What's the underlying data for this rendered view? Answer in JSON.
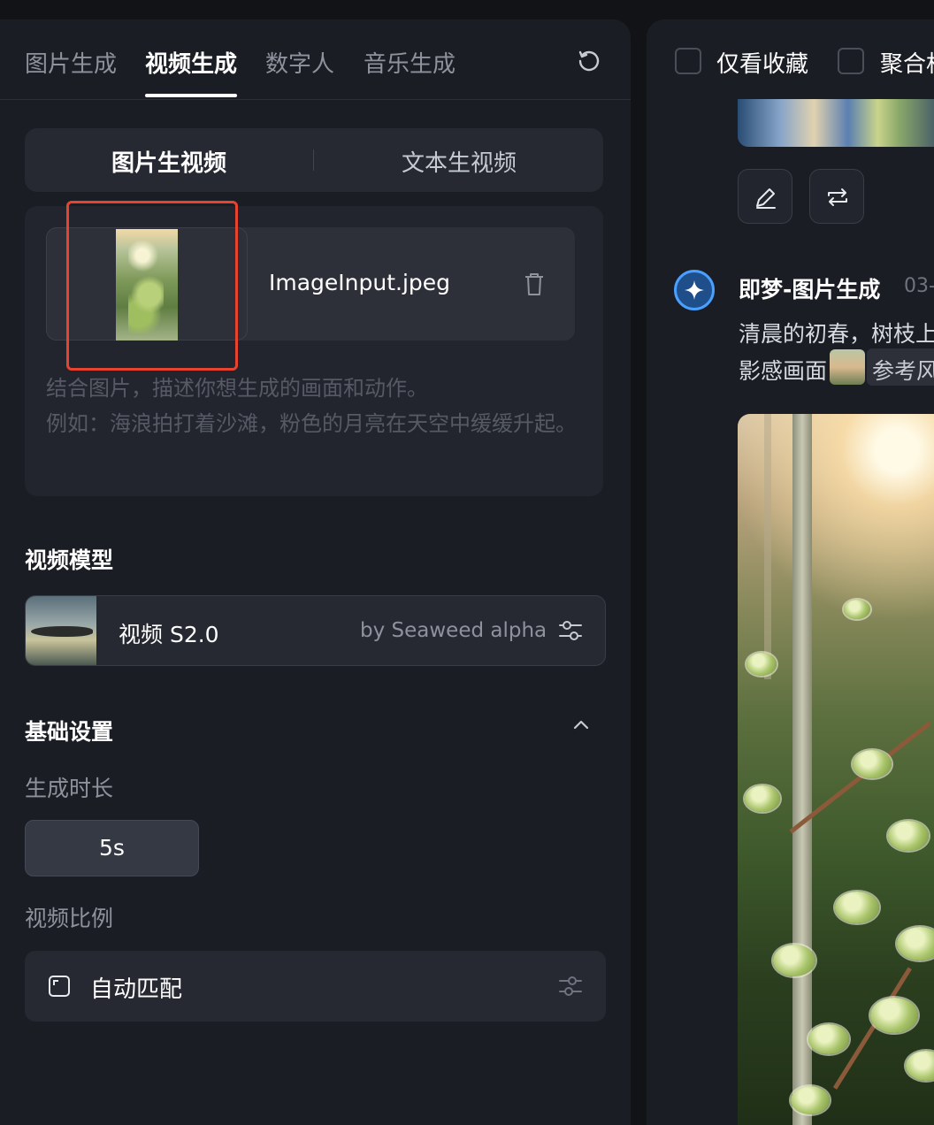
{
  "tabs": [
    {
      "label": "图片生成"
    },
    {
      "label": "视频生成"
    },
    {
      "label": "数字人"
    },
    {
      "label": "音乐生成"
    }
  ],
  "mode_switch": {
    "image_to_video": "图片生视频",
    "text_to_video": "文本生视频"
  },
  "upload": {
    "file_name": "ImageInput.jpeg",
    "prompt_placeholder_line1": "结合图片，描述你想生成的画面和动作。",
    "prompt_placeholder_line2": "例如：海浪拍打着沙滩，粉色的月亮在天空中缓缓升起。"
  },
  "video_model": {
    "section_title": "视频模型",
    "name": "视频 S2.0",
    "by": "by Seaweed alpha"
  },
  "basic_settings": {
    "section_title": "基础设置",
    "duration_label": "生成时长",
    "duration_value": "5s",
    "ratio_label": "视频比例",
    "ratio_value": "自动匹配"
  },
  "feed": {
    "filter_favorites": "仅看收藏",
    "filter_aggregate": "聚合相",
    "sender": "即梦-图片生成",
    "timestamp": "03-",
    "message_line1": "清晨的初春，树枝上",
    "message_line2": "影感画面",
    "ref_chip": "参考风"
  },
  "colors": {
    "highlight": "#e8432f",
    "accent": "#4aa0ff"
  }
}
